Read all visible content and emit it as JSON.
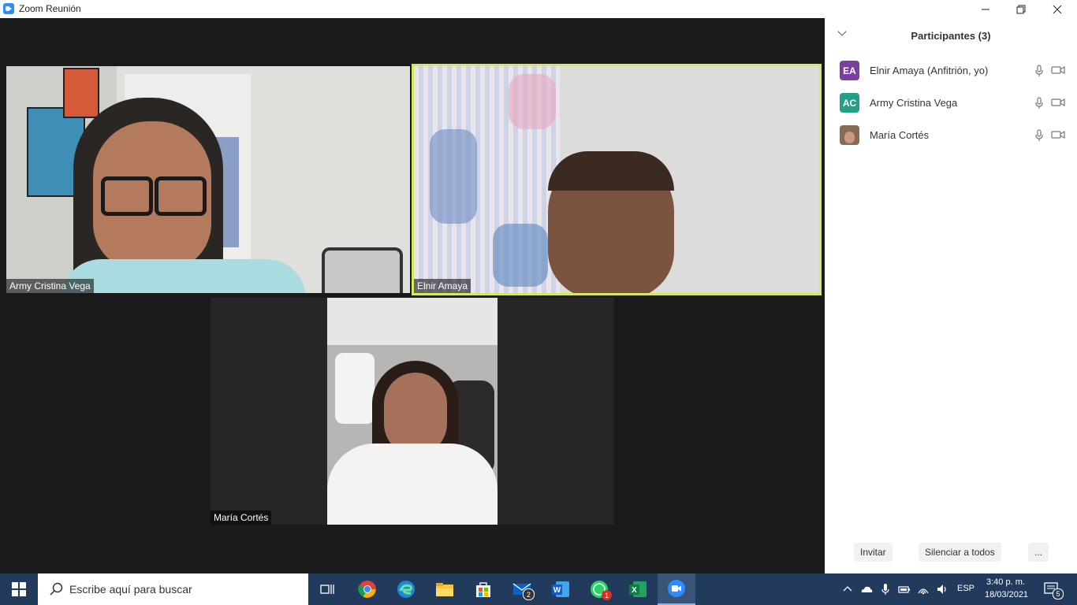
{
  "window": {
    "title": "Zoom Reunión"
  },
  "colors": {
    "accent": "#2d8cff",
    "active_speaker_border": "#d7e85f",
    "taskbar": "#223a5c"
  },
  "video_tiles": [
    {
      "name": "Army Cristina Vega"
    },
    {
      "name": "Elnir Amaya",
      "active_speaker": true
    },
    {
      "name": "María Cortés"
    }
  ],
  "sidebar": {
    "title": "Participantes (3)",
    "participants": [
      {
        "initials": "EA",
        "name": "Elnir Amaya (Anfitrión, yo)",
        "avatar_color": "#7b3fa3",
        "icons": [
          "mic-icon",
          "video-camera-icon"
        ]
      },
      {
        "initials": "AC",
        "name": "Army Cristina Vega",
        "avatar_color": "#22a08a",
        "icons": [
          "mic-icon",
          "video-camera-icon"
        ]
      },
      {
        "initials": "",
        "name": "María Cortés",
        "avatar_color": "#8a6a55",
        "icons": [
          "mic-icon",
          "video-camera-icon"
        ]
      }
    ],
    "footer": {
      "invite_label": "Invitar",
      "mute_all_label": "Silenciar a todos",
      "more_label": "..."
    }
  },
  "taskbar": {
    "search_placeholder": "Escribe aquí para buscar",
    "apps": [
      {
        "name": "task-view-icon"
      },
      {
        "name": "chrome-icon"
      },
      {
        "name": "edge-icon"
      },
      {
        "name": "file-explorer-icon"
      },
      {
        "name": "microsoft-store-icon"
      },
      {
        "name": "mail-icon",
        "badge": "2"
      },
      {
        "name": "word-icon"
      },
      {
        "name": "whatsapp-icon",
        "badge": "1"
      },
      {
        "name": "excel-icon"
      },
      {
        "name": "zoom-icon"
      }
    ],
    "tray": {
      "language": "ESP",
      "time": "3:40 p. m.",
      "date": "18/03/2021",
      "notifications_count": "5"
    }
  }
}
